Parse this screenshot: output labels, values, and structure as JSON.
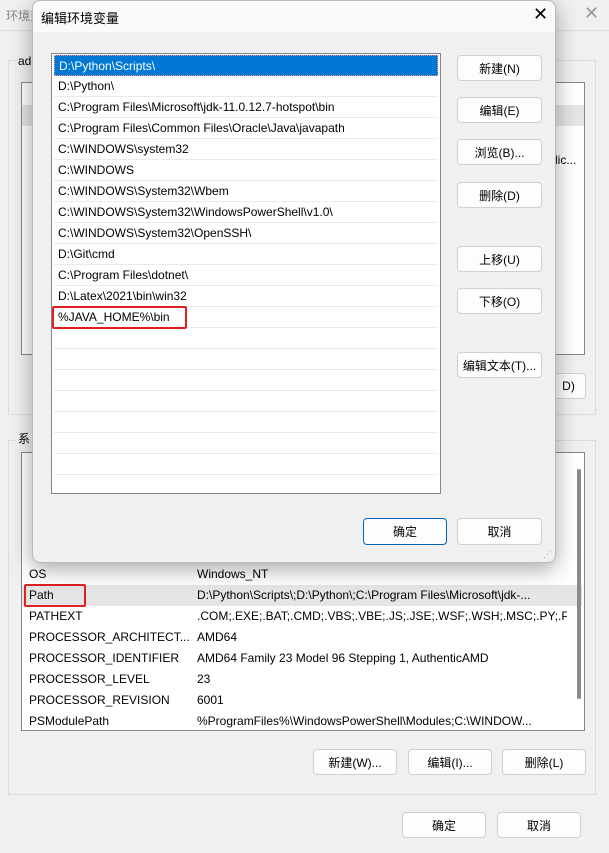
{
  "parent": {
    "title": "环境变量",
    "user_group_label": "ad",
    "user_partial_value": "lic...",
    "user_partial_button": "D)",
    "system_group_label": "系",
    "system_vars": [
      {
        "name": "OS",
        "value": "Windows_NT"
      },
      {
        "name": "Path",
        "value": "D:\\Python\\Scripts\\;D:\\Python\\;C:\\Program Files\\Microsoft\\jdk-..."
      },
      {
        "name": "PATHEXT",
        "value": ".COM;.EXE;.BAT;.CMD;.VBS;.VBE;.JS;.JSE;.WSF;.WSH;.MSC;.PY;.P..."
      },
      {
        "name": "PROCESSOR_ARCHITECT...",
        "value": "AMD64"
      },
      {
        "name": "PROCESSOR_IDENTIFIER",
        "value": "AMD64 Family 23 Model 96 Stepping 1, AuthenticAMD"
      },
      {
        "name": "PROCESSOR_LEVEL",
        "value": "23"
      },
      {
        "name": "PROCESSOR_REVISION",
        "value": "6001"
      },
      {
        "name": "PSModulePath",
        "value": "%ProgramFiles%\\WindowsPowerShell\\Modules;C:\\WINDOW..."
      }
    ],
    "system_buttons": {
      "new": "新建(W)...",
      "edit": "编辑(I)...",
      "delete": "删除(L)"
    },
    "ok": "确定",
    "cancel": "取消"
  },
  "dialog": {
    "title": "编辑环境变量",
    "entries": [
      "D:\\Python\\Scripts\\",
      "D:\\Python\\",
      "C:\\Program Files\\Microsoft\\jdk-11.0.12.7-hotspot\\bin",
      "C:\\Program Files\\Common Files\\Oracle\\Java\\javapath",
      "C:\\WINDOWS\\system32",
      "C:\\WINDOWS",
      "C:\\WINDOWS\\System32\\Wbem",
      "C:\\WINDOWS\\System32\\WindowsPowerShell\\v1.0\\",
      "C:\\WINDOWS\\System32\\OpenSSH\\",
      "D:\\Git\\cmd",
      "C:\\Program Files\\dotnet\\",
      "D:\\Latex\\2021\\bin\\win32",
      "%JAVA_HOME%\\bin"
    ],
    "selected_index": 0,
    "buttons": {
      "new": "新建(N)",
      "edit": "编辑(E)",
      "browse": "浏览(B)...",
      "delete": "删除(D)",
      "up": "上移(U)",
      "down": "下移(O)",
      "edit_text": "编辑文本(T)..."
    },
    "ok": "确定",
    "cancel": "取消"
  }
}
